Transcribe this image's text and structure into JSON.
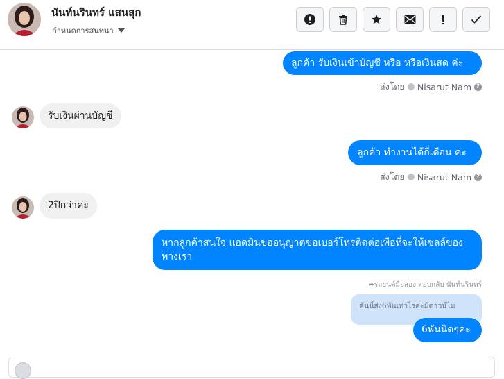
{
  "header": {
    "contact_name": "นันท์นรินทร์ แสนสุก",
    "status_label": "กำหนดการสนทนา",
    "toolbar": {
      "icons": [
        "exclamation-circle-icon",
        "trash-icon",
        "star-icon",
        "envelope-icon",
        "exclamation-icon",
        "check-icon"
      ]
    }
  },
  "messages": [
    {
      "direction": "out",
      "text": "ลูกค้า รับเงินเข้าบัญชี หรือ หรือเงินสด ค่ะ"
    },
    {
      "direction": "in",
      "text": "รับเงินผ่านบัญชี"
    },
    {
      "direction": "out",
      "text": "ลูกค้า ทำงานได้กี่เดือน ค่ะ"
    },
    {
      "direction": "in",
      "text": "2ปีกว่าค่ะ"
    },
    {
      "direction": "out",
      "text": "หากลูกค้าสนใจ แอดมินขออนุญาตขอเบอร์โทรติดต่อเพื่อที่จะให้เซลล์ของทางเรา"
    },
    {
      "direction": "out",
      "text": "6พันนิดๆค่ะ"
    }
  ],
  "sent_by": {
    "prefix": "ส่งโดย",
    "name": "Nisarut Nam"
  },
  "reply": {
    "label": "รถยนต์มือสอง ตอบกลับ นันท์นรินทร์",
    "quoted_text": "คันนี้ส่ง6พันเท่าไรค่ะมีดาวน์ไม"
  },
  "colors": {
    "accent": "#0084ff",
    "incoming_bubble": "#f1f0f0",
    "quoted_bg": "#cfe4fb"
  }
}
